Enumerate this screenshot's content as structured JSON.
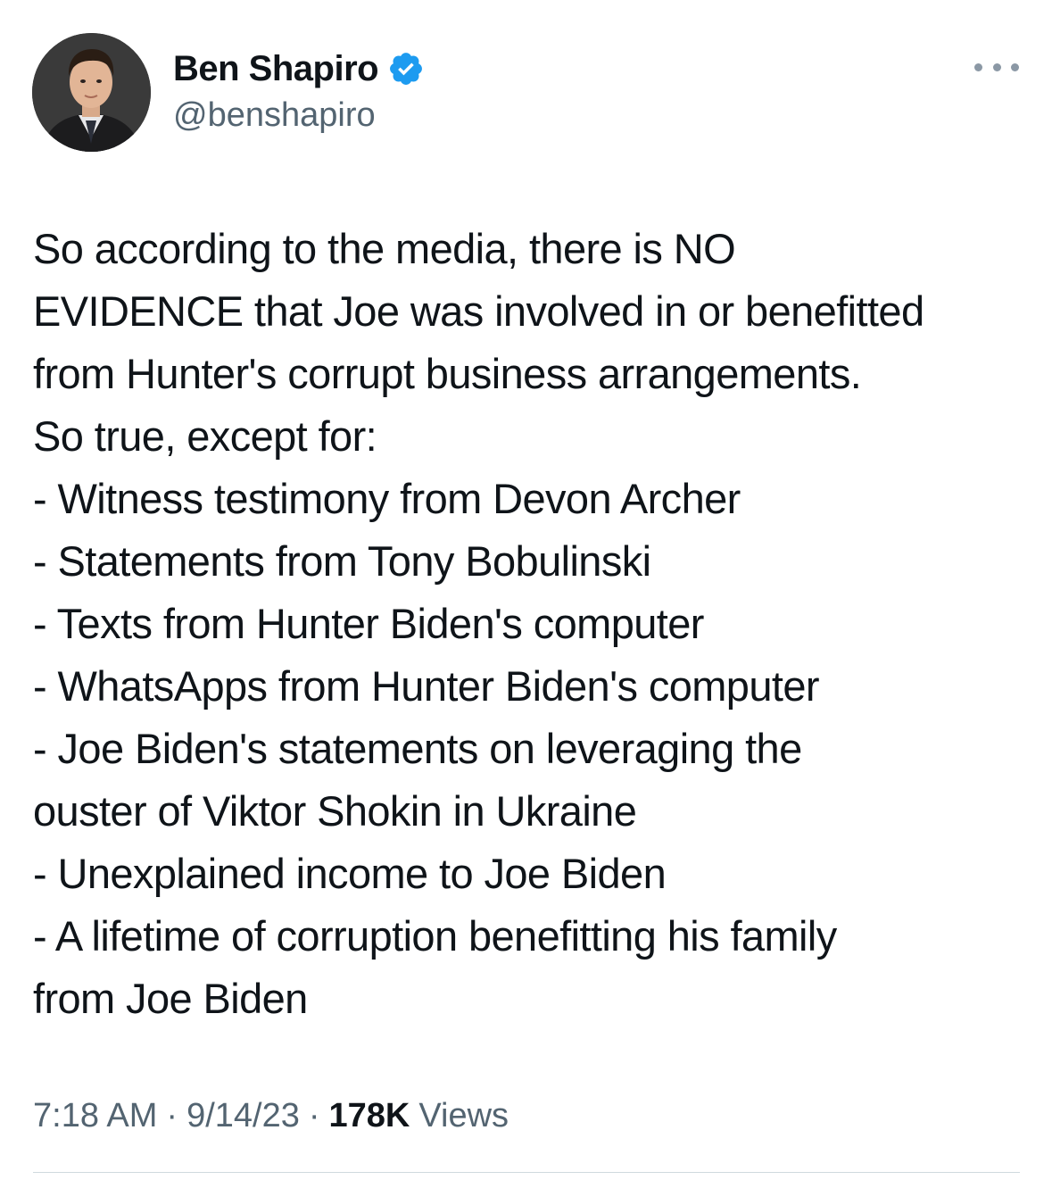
{
  "author": {
    "display_name": "Ben Shapiro",
    "handle": "@benshapiro",
    "verified": true,
    "verified_color": "#1d9bf0",
    "avatar_icon": "profile-photo"
  },
  "more_icon": "more-horizontal-icon",
  "tweet": {
    "lines": [
      "So according to the media, there is NO",
      "EVIDENCE that Joe was involved in or benefitted",
      "from Hunter's corrupt business arrangements.",
      "So true, except for:",
      "- Witness testimony from Devon Archer",
      "- Statements from Tony Bobulinski",
      "- Texts from Hunter Biden's computer",
      "- WhatsApps from Hunter Biden's computer",
      "- Joe Biden's statements on leveraging the",
      "ouster of Viktor Shokin in Ukraine",
      "- Unexplained income to Joe Biden",
      "- A lifetime of corruption benefitting his family",
      "from Joe Biden"
    ]
  },
  "meta": {
    "time": "7:18 AM",
    "separator": "·",
    "date": "9/14/23",
    "views_count": "178K",
    "views_label": "Views"
  },
  "colors": {
    "text": "#0f1419",
    "secondary": "#536471",
    "divider": "#cfd9de"
  }
}
